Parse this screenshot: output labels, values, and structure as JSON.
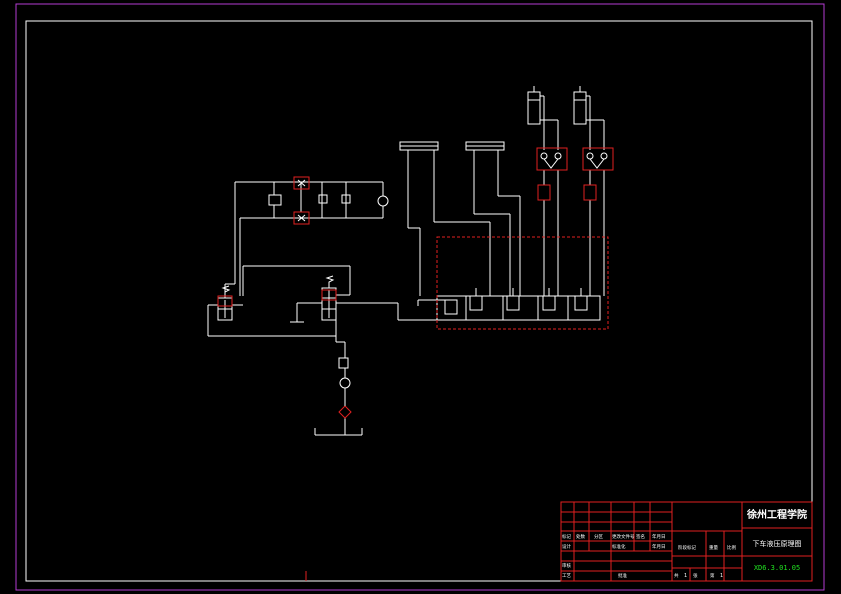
{
  "colors": {
    "background": "#000000",
    "outer_border": "#b43cd2",
    "frame": "#ffffff",
    "lines": "#ffffff",
    "highlight": "#e02020",
    "title_block": "#e02020",
    "drawing_no": "#20e020"
  },
  "title_block": {
    "school": "徐州工程学院",
    "drawing_title": "下车液压原理图",
    "drawing_no": "XD6.3.01.05",
    "labels": {
      "mark": "标记",
      "count": "处数",
      "zone": "分区",
      "change_doc": "更改文件号",
      "sign": "签名",
      "date": "年月日",
      "design": "设计",
      "standardize": "标准化",
      "date2": "年月日",
      "stage_mark": "阶段标记",
      "weight": "重量",
      "scale": "比例",
      "review": "审核",
      "process": "工艺",
      "approve": "批准",
      "sheets_total": "共",
      "sheet_unit": "张",
      "sheet_no": "第",
      "sheets_count": "1",
      "sheet_index": "1"
    }
  }
}
